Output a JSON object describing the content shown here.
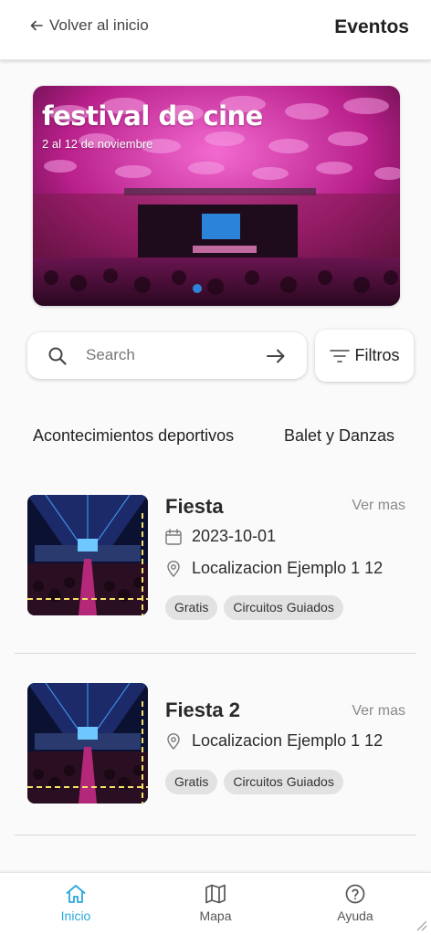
{
  "header": {
    "back_label": "Volver al inicio",
    "title": "Eventos"
  },
  "banner": {
    "title": "festival de cine",
    "subtitle": "2 al 12 de noviembre"
  },
  "search": {
    "placeholder": "Search",
    "filters_label": "Filtros"
  },
  "categories": [
    "Acontecimientos deportivos",
    "Balet y Danzas"
  ],
  "events": [
    {
      "title": "Fiesta",
      "more_label": "Ver mas",
      "date": "2023-10-01",
      "location": "Localizacion Ejemplo 1 12",
      "tags": [
        "Gratis",
        "Circuitos Guiados"
      ]
    },
    {
      "title": "Fiesta 2",
      "more_label": "Ver mas",
      "location": "Localizacion Ejemplo 1 12",
      "tags": [
        "Gratis",
        "Circuitos Guiados"
      ]
    }
  ],
  "bottom_nav": [
    {
      "label": "Inicio",
      "icon": "home-icon",
      "active": true
    },
    {
      "label": "Mapa",
      "icon": "map-icon",
      "active": false
    },
    {
      "label": "Ayuda",
      "icon": "help-icon",
      "active": false
    }
  ],
  "colors": {
    "accent": "#2aa8dc",
    "tag_bg": "#e2e2e2",
    "banner_magenta": "#d8369e"
  }
}
